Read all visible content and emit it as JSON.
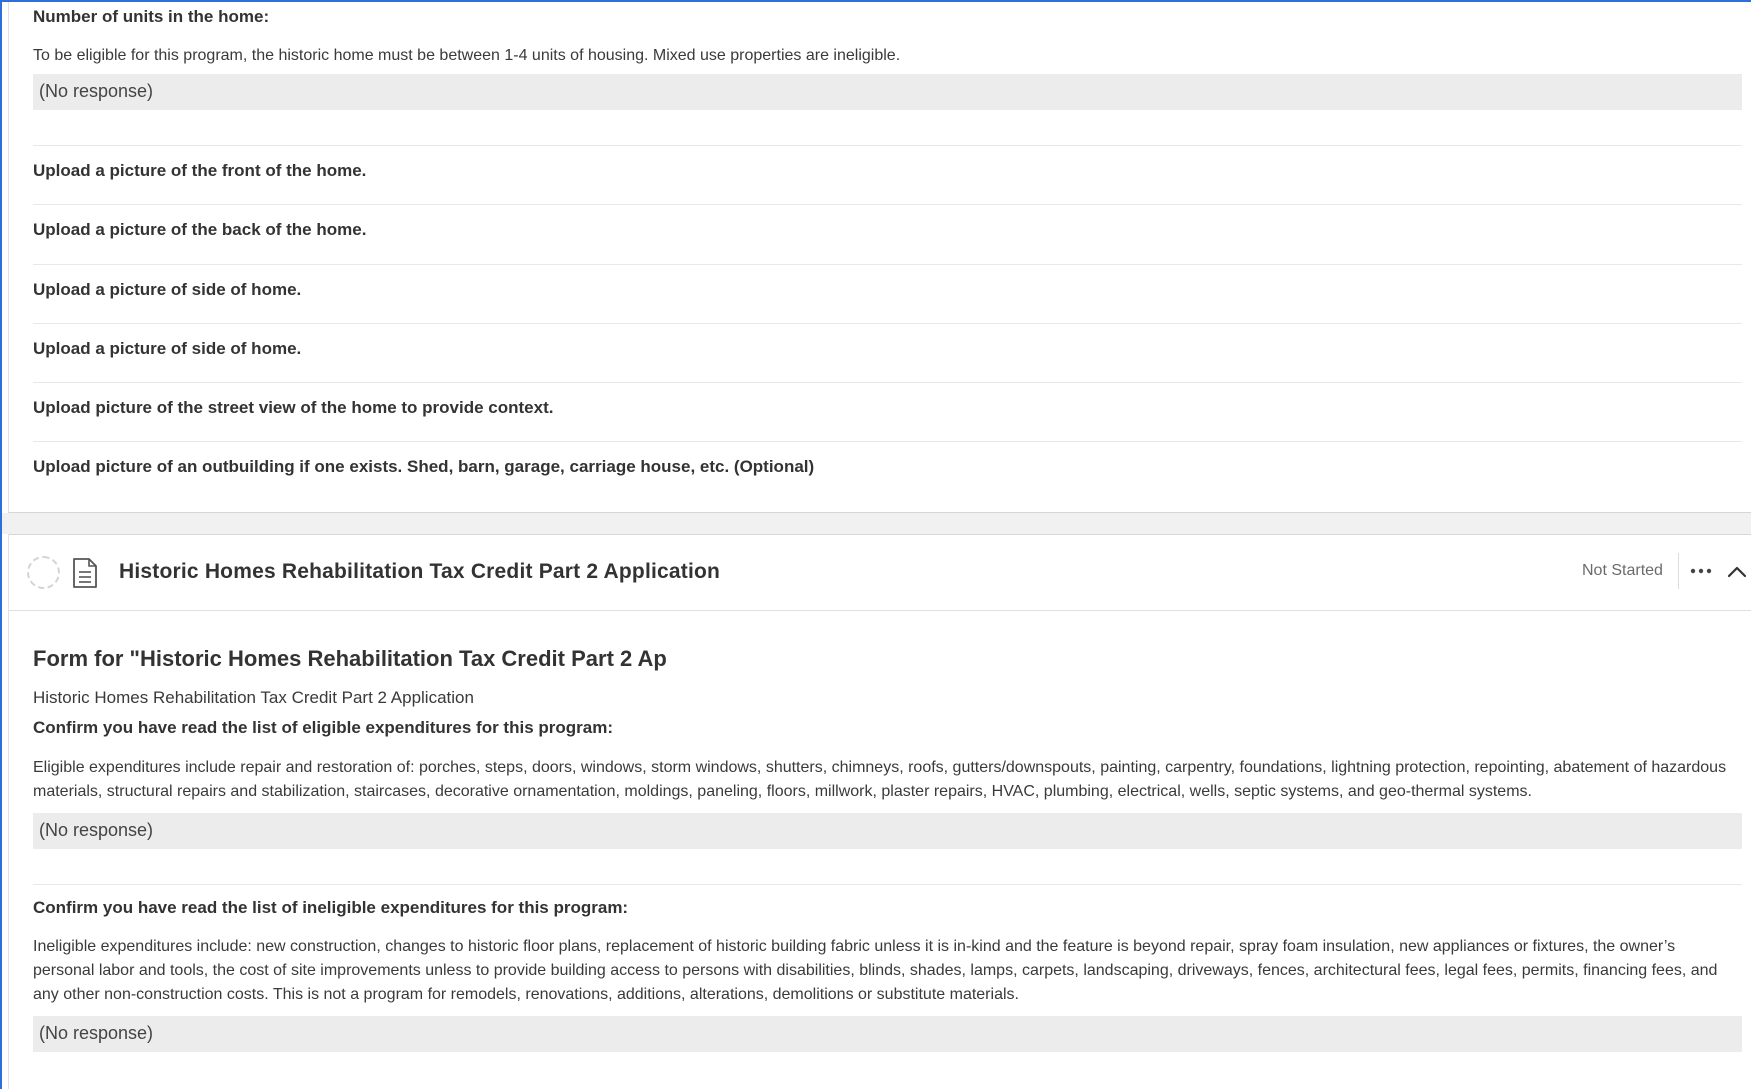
{
  "section1": {
    "units_question": "Number of units in the home:",
    "units_description": "To be eligible for this program, the historic home must be between 1-4 units of housing. Mixed use properties are ineligible.",
    "units_response": "(No response)",
    "upload_items": [
      "Upload a picture of the front of the home.",
      "Upload a picture of the back of the home.",
      "Upload a picture of side of home.",
      "Upload a picture of side of home.",
      "Upload picture of the street view of the home to provide context.",
      "Upload picture of an outbuilding if one exists. Shed, barn, garage, carriage house, etc. (Optional)"
    ]
  },
  "section2": {
    "title": "Historic Homes Rehabilitation Tax Credit Part 2 Application",
    "status": "Not Started",
    "more_icon": "more-horizontal-icon",
    "collapse_icon": "chevron-up-icon",
    "form_title": "Form for \"Historic Homes Rehabilitation Tax Credit Part 2 Ap",
    "form_subtitle": "Historic Homes Rehabilitation Tax Credit Part 2 Application",
    "eligible_question": "Confirm you have read the list of eligible expenditures for this program:",
    "eligible_description": "Eligible expenditures include repair and restoration of: porches, steps, doors, windows, storm windows, shutters, chimneys, roofs, gutters/downspouts, painting, carpentry, foundations, lightning protection, repointing, abatement of hazardous materials, structural repairs and stabilization, staircases, decorative ornamentation, moldings, paneling, floors, millwork, plaster repairs, HVAC, plumbing, electrical, wells, septic systems, and geo-thermal systems.",
    "eligible_response": "(No response)",
    "ineligible_question": "Confirm you have read the list of ineligible expenditures for this program:",
    "ineligible_description": "Ineligible expenditures include: new construction, changes to historic floor plans, replacement of historic building fabric unless it is in-kind and the feature is beyond repair, spray foam insulation, new appliances or fixtures, the owner’s personal labor and tools, the cost of site improvements unless to provide building access to persons with disabilities, blinds, shades, lamps, carpets, landscaping, driveways, fences, architectural fees, legal fees, permits, financing fees, and any other non-construction costs. This is not a program for remodels, renovations, additions, alterations, demolitions or substitute materials.",
    "ineligible_response": "(No response)"
  },
  "colors": {
    "accent": "#2f6fdb",
    "response_bg": "#ececec",
    "section_gap": "#f1f1f1"
  }
}
